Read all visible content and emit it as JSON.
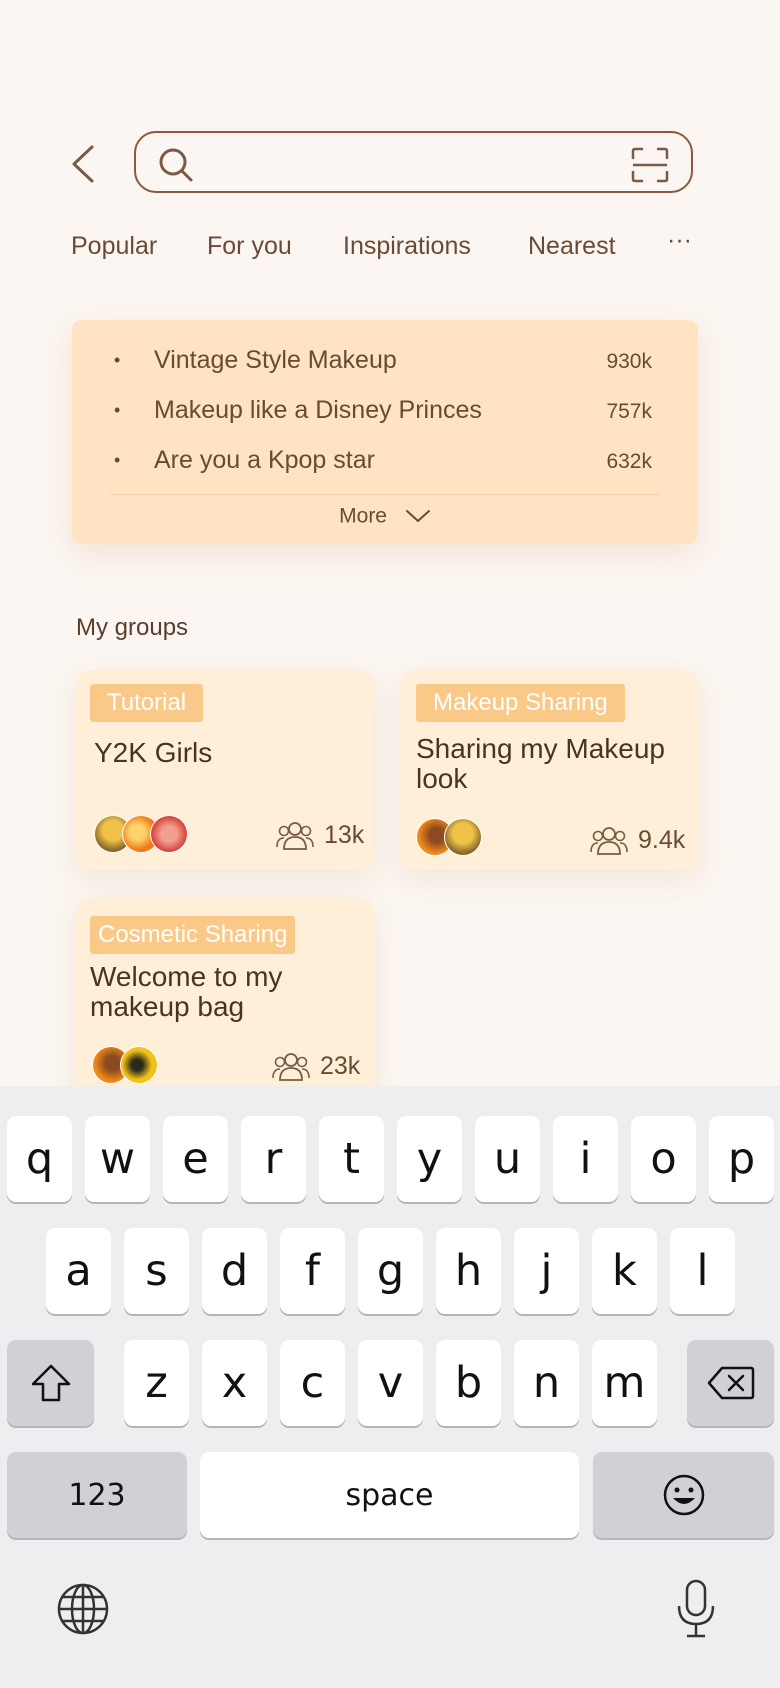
{
  "search": {
    "value": "",
    "placeholder": ""
  },
  "tabs": [
    "Popular",
    "For you",
    "Inspirations",
    "Nearest",
    "···"
  ],
  "trending": {
    "items": [
      {
        "title": "Vintage Style Makeup",
        "count": "930k"
      },
      {
        "title": "Makeup like a Disney Princes",
        "count": "757k"
      },
      {
        "title": "Are you a Kpop star",
        "count": "632k"
      }
    ],
    "bullet": "•",
    "more_label": "More"
  },
  "groups": {
    "heading": "My groups",
    "cards": [
      {
        "tag": "Tutorial",
        "title": "Y2K Girls",
        "members": "13k"
      },
      {
        "tag": "Makeup Sharing",
        "title": "Sharing my Makeup look",
        "members": "9.4k"
      },
      {
        "tag": "Cosmetic Sharing",
        "title": "Welcome to my makeup bag",
        "members": "23k"
      }
    ]
  },
  "keyboard": {
    "row1": [
      "q",
      "w",
      "e",
      "r",
      "t",
      "y",
      "u",
      "i",
      "o",
      "p"
    ],
    "row2": [
      "a",
      "s",
      "d",
      "f",
      "g",
      "h",
      "j",
      "k",
      "l"
    ],
    "row3": [
      "z",
      "x",
      "c",
      "v",
      "b",
      "n",
      "m"
    ],
    "numbers_label": "123",
    "space_label": "space"
  },
  "colors": {
    "accent": "#fbc987",
    "panel": "#ffe3c2",
    "card": "#ffefd9",
    "text": "#5a3e2b"
  }
}
